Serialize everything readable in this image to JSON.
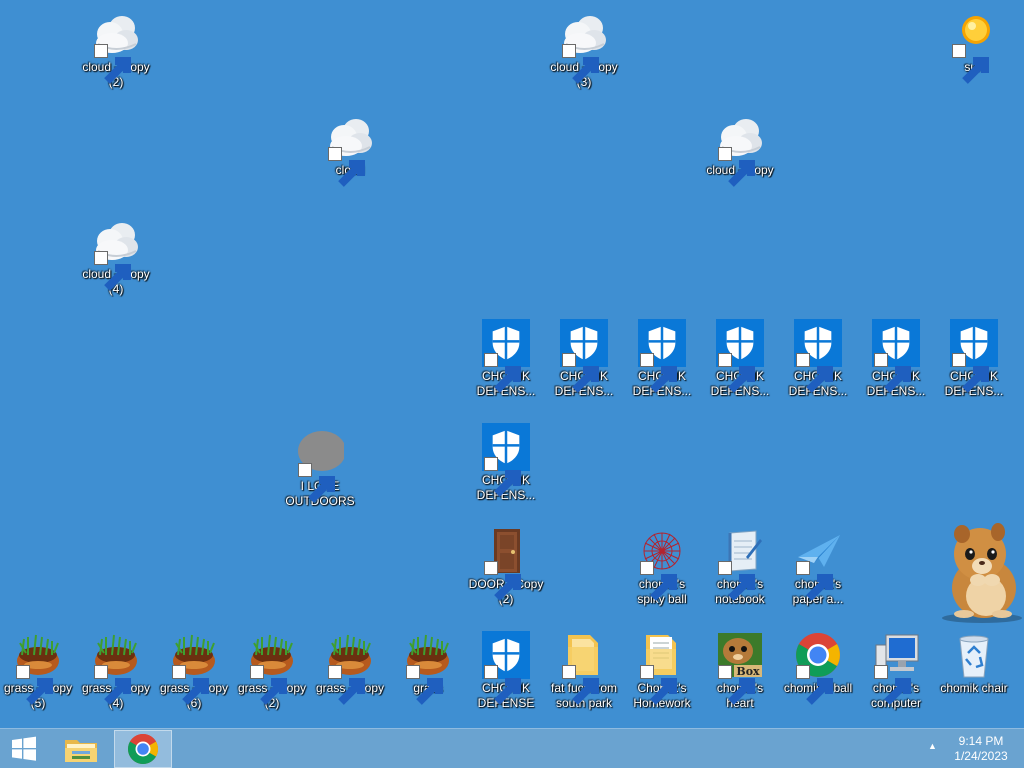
{
  "desktop": {
    "icons": [
      {
        "label": "cloud - Copy\n(2)",
        "type": "cloud"
      },
      {
        "label": "cloud - Copy\n(3)",
        "type": "cloud"
      },
      {
        "label": "sun",
        "type": "sun"
      },
      {
        "label": "cloud",
        "type": "cloud"
      },
      {
        "label": "cloud - Copy",
        "type": "cloud"
      },
      {
        "label": "cloud - Copy\n(4)",
        "type": "cloud"
      },
      {
        "label": "CHOMIK\nDEFENS...",
        "type": "shield"
      },
      {
        "label": "CHOMIK\nDEFENS...",
        "type": "shield"
      },
      {
        "label": "CHOMIK\nDEFENS...",
        "type": "shield"
      },
      {
        "label": "CHOMIK\nDEFENS...",
        "type": "shield"
      },
      {
        "label": "CHOMIK\nDEFENS...",
        "type": "shield"
      },
      {
        "label": "CHOMIK\nDEFENS...",
        "type": "shield"
      },
      {
        "label": "CHOMIK\nDEFENS...",
        "type": "shield"
      },
      {
        "label": "CHOMIK\nDEFENS...",
        "type": "shield"
      },
      {
        "label": "I LOVE\nOUTDOORS",
        "type": "blob"
      },
      {
        "label": "DOOR - Copy\n(2)",
        "type": "door"
      },
      {
        "label": "chomik's\nspiky ball",
        "type": "spiky-ball"
      },
      {
        "label": "chomik's\nnotebook",
        "type": "notebook"
      },
      {
        "label": "chomik's\npaper a...",
        "type": "paper-airplane"
      },
      {
        "label": "grass - Copy\n(5)",
        "type": "grass"
      },
      {
        "label": "grass - Copy\n(4)",
        "type": "grass"
      },
      {
        "label": "grass - Copy\n(6)",
        "type": "grass"
      },
      {
        "label": "grass - Copy\n(2)",
        "type": "grass"
      },
      {
        "label": "grass - Copy",
        "type": "grass"
      },
      {
        "label": "grass",
        "type": "grass"
      },
      {
        "label": "CHOMIK\nDEFENSE",
        "type": "shield"
      },
      {
        "label": "fat fuck from\nsouth park",
        "type": "folder"
      },
      {
        "label": "Chomik's\nHomework",
        "type": "folder-docs"
      },
      {
        "label": "chomik's\nheart",
        "type": "box-game"
      },
      {
        "label": "chomik's ball",
        "type": "chrome"
      },
      {
        "label": "chomik's\ncomputer",
        "type": "computer"
      },
      {
        "label": "chomik chair",
        "type": "recycle-bin"
      }
    ]
  },
  "taskbar": {
    "clock_time": "9:14 PM",
    "clock_date": "1/24/2023",
    "tray_arrow": "▲",
    "buttons": [
      "start",
      "file-explorer",
      "chrome"
    ]
  }
}
